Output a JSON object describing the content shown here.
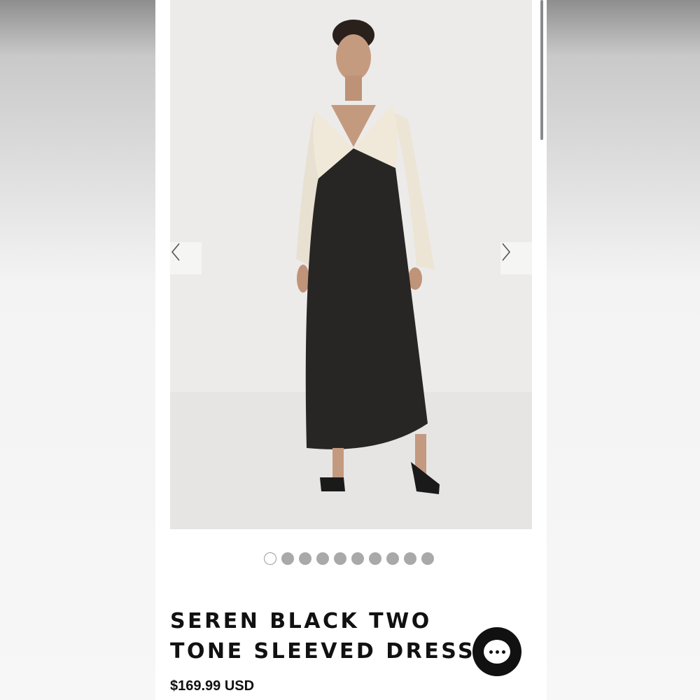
{
  "product": {
    "title_line1": "SEREN BLACK TWO",
    "title_line2": "TONE SLEEVED DRESS",
    "price": "$169.99 USD"
  },
  "gallery": {
    "image_subject": "dress-photo",
    "slide_count": 10,
    "active_slide": 1
  },
  "icons": {
    "prev": "chevron-left-icon",
    "next": "chevron-right-icon",
    "chat": "chat-bubble-icon"
  },
  "colors": {
    "text": "#111111",
    "dot_inactive": "#a9a9a9",
    "chat_button": "#111111"
  }
}
